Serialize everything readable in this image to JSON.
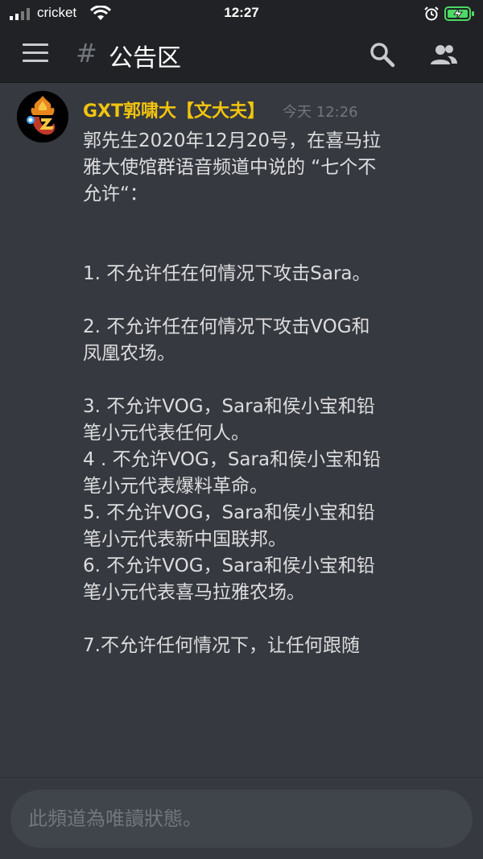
{
  "status_bar": {
    "carrier": "cricket",
    "time": "12:27"
  },
  "header": {
    "hash_symbol": "#",
    "channel_name": "公告区"
  },
  "message": {
    "username": "GXT郭啸大【文大夫】",
    "timestamp": "今天 12:26",
    "username_color": "#f1c40f",
    "lines": [
      "郭先生2020年12月20号，在喜马拉",
      "雅大使馆群语音频道中说的 “七个不",
      "允许“：",
      "1. 不允许任在何情况下攻击Sara。",
      "2. 不允许任在何情况下攻击VOG和",
      "凤凰农场。",
      "3. 不允许VOG，Sara和侯小宝和铅",
      "笔小元代表任何人。",
      "4 . 不允许VOG，Sara和侯小宝和铅",
      "笔小元代表爆料革命。",
      "5. 不允许VOG，Sara和侯小宝和铅",
      "笔小元代表新中国联邦。",
      "6. 不允许VOG，Sara和侯小宝和铅",
      "笔小元代表喜马拉雅农场。",
      " 7.不允许任何情况下，让任何跟随"
    ]
  },
  "composer": {
    "placeholder": "此頻道為唯讀狀態。"
  },
  "icons": {
    "menu": "hamburger-icon",
    "search": "search-icon",
    "members": "members-icon",
    "wifi": "wifi-icon",
    "alarm": "alarm-icon",
    "battery": "battery-charging-icon"
  },
  "colors": {
    "background": "#36393f",
    "header": "#202225",
    "battery": "#4cd964"
  }
}
